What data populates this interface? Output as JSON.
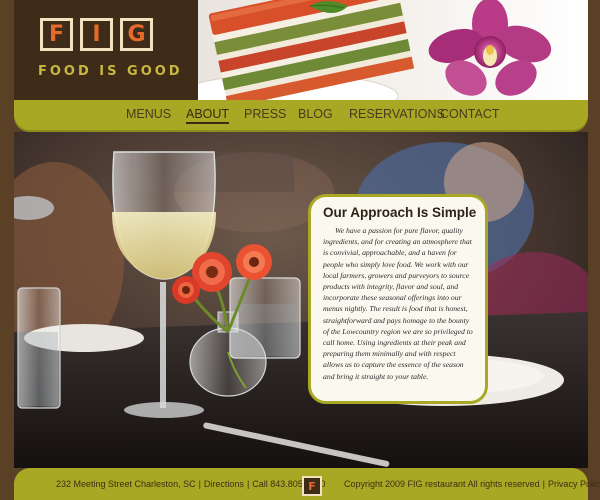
{
  "brand": {
    "letters": [
      "F",
      "I",
      "G"
    ],
    "tagline": "FOOD IS GOOD",
    "accent_color": "#e56a2c",
    "tagline_color": "#c9b840"
  },
  "header": {
    "photo_left": "stacked vegetable terrine",
    "photo_right": "pink orchid flower"
  },
  "nav": {
    "items": [
      {
        "label": "MENUS"
      },
      {
        "label": "ABOUT"
      },
      {
        "label": "PRESS"
      },
      {
        "label": "BLOG"
      },
      {
        "label": "RESERVATIONS"
      },
      {
        "label": "CONTACT"
      }
    ],
    "active": "ABOUT",
    "bar_color": "#a8a824"
  },
  "hero": {
    "scene": "restaurant table with wine glass and red gerbera daisies"
  },
  "approach": {
    "title": "Our Approach Is Simple",
    "body": "We have a passion for pure flavor, quality ingredients, and for creating an atmosphere that is convivial, approachable, and a haven for people who simply love food. We work with our local farmers, growers and purveyors to source products with integrity, flavor and soul, and incorporate these seasonal offerings into our menus nightly. The result is food that is honest, straightforward and pays homage to the bounty of the Lowcountry region we are so privileged to call home. Using ingredients at their peak and preparing them minimally and with respect allows us to capture the essence of the season and bring it straight to your table."
  },
  "footer": {
    "address": "232 Meeting Street Charleston, SC",
    "directions": "Directions",
    "phone": "Call 843.805.5900",
    "badge_letter": "F",
    "copyright": "Copyright 2009 FIG restaurant All rights reserved",
    "privacy": "Privacy Policy"
  }
}
